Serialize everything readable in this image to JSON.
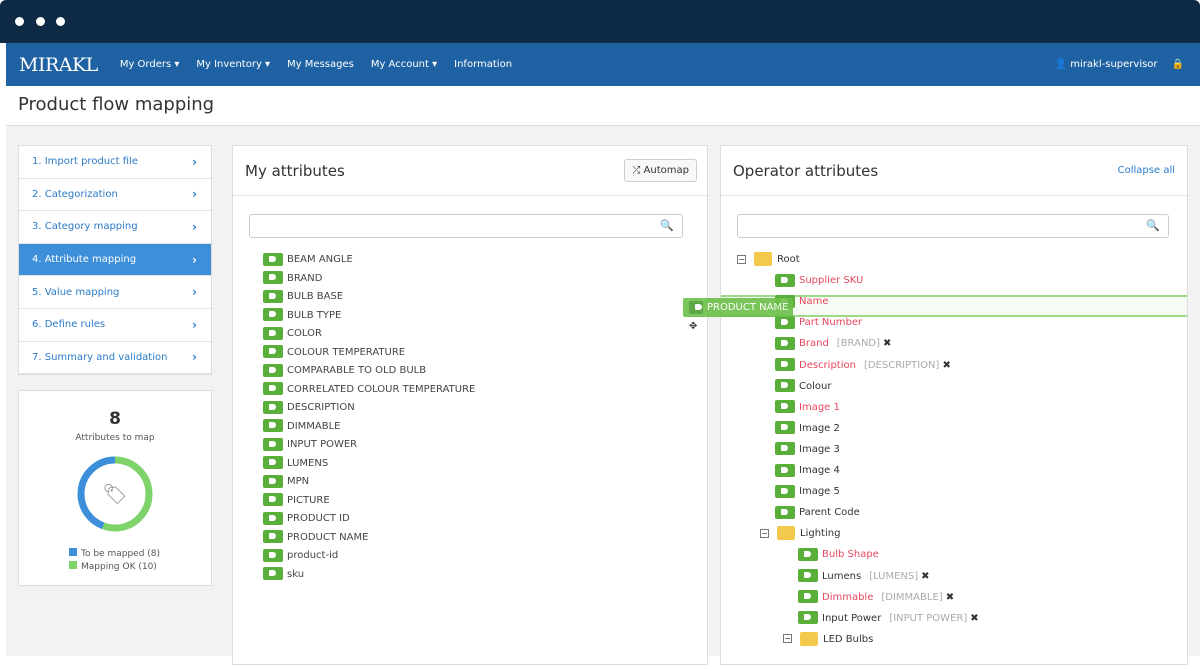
{
  "nav": {
    "logo": "MIRAKL",
    "items": [
      "My Orders ▾",
      "My Inventory ▾",
      "My Messages",
      "My Account ▾",
      "Information"
    ],
    "user": "👤 mirakl-supervisor",
    "lock": "🔒"
  },
  "page_title": "Product flow mapping",
  "steps": [
    {
      "label": "1. Import product file",
      "active": false
    },
    {
      "label": "2. Categorization",
      "active": false
    },
    {
      "label": "3. Category mapping",
      "active": false
    },
    {
      "label": "4. Attribute mapping",
      "active": true
    },
    {
      "label": "5. Value mapping",
      "active": false
    },
    {
      "label": "6. Define rules",
      "active": false
    },
    {
      "label": "7. Summary and validation",
      "active": false
    }
  ],
  "stats": {
    "count": "8",
    "label": "Attributes to map",
    "legend": [
      "To be mapped (8)",
      "Mapping OK (10)"
    ],
    "to_be_mapped": 8,
    "mapping_ok": 10,
    "colors": [
      "#3d8fd9",
      "#7ed36b"
    ]
  },
  "my_attributes": {
    "title": "My attributes",
    "automap": "⤮ Automap",
    "search_icon": "🔍",
    "items": [
      "BEAM ANGLE",
      "BRAND",
      "BULB BASE",
      "BULB TYPE",
      "COLOR",
      "COLOUR TEMPERATURE",
      "COMPARABLE TO OLD BULB",
      "CORRELATED COLOUR TEMPERATURE",
      "DESCRIPTION",
      "DIMMABLE",
      "INPUT POWER",
      "LUMENS",
      "MPN",
      "PICTURE",
      "PRODUCT ID",
      "PRODUCT NAME",
      "product-id",
      "sku"
    ]
  },
  "operator": {
    "title": "Operator attributes",
    "collapse": "Collapse all",
    "search_icon": "🔍",
    "nodes": [
      {
        "type": "folder",
        "label": "Root",
        "level": 0
      },
      {
        "type": "attr",
        "label": "Supplier SKU",
        "required": true,
        "level": 1
      },
      {
        "type": "attr",
        "label": "Name",
        "required": true,
        "level": 1
      },
      {
        "type": "attr",
        "label": "Part Number",
        "required": true,
        "level": 1
      },
      {
        "type": "attr",
        "label": "Brand",
        "required": true,
        "mapped": "[BRAND]",
        "level": 1
      },
      {
        "type": "attr",
        "label": "Description",
        "required": true,
        "mapped": "[DESCRIPTION]",
        "level": 1
      },
      {
        "type": "attr",
        "label": "Colour",
        "required": false,
        "level": 1
      },
      {
        "type": "attr",
        "label": "Image 1",
        "required": true,
        "level": 1
      },
      {
        "type": "attr",
        "label": "Image 2",
        "required": false,
        "level": 1
      },
      {
        "type": "attr",
        "label": "Image 3",
        "required": false,
        "level": 1
      },
      {
        "type": "attr",
        "label": "Image 4",
        "required": false,
        "level": 1
      },
      {
        "type": "attr",
        "label": "Image 5",
        "required": false,
        "level": 1
      },
      {
        "type": "attr",
        "label": "Parent Code",
        "required": false,
        "level": 1
      },
      {
        "type": "folder",
        "label": "Lighting",
        "level": 1
      },
      {
        "type": "attr",
        "label": "Bulb Shape",
        "required": true,
        "level": 2
      },
      {
        "type": "attr",
        "label": "Lumens",
        "required": false,
        "mapped": "[LUMENS]",
        "level": 2
      },
      {
        "type": "attr",
        "label": "Dimmable",
        "required": true,
        "mapped": "[DIMMABLE]",
        "level": 2
      },
      {
        "type": "attr",
        "label": "Input Power",
        "required": false,
        "mapped": "[INPUT POWER]",
        "level": 2
      },
      {
        "type": "folder",
        "label": "LED Bulbs",
        "level": 2
      }
    ]
  },
  "drag_item": "PRODUCT NAME",
  "remove_icon": "✖"
}
